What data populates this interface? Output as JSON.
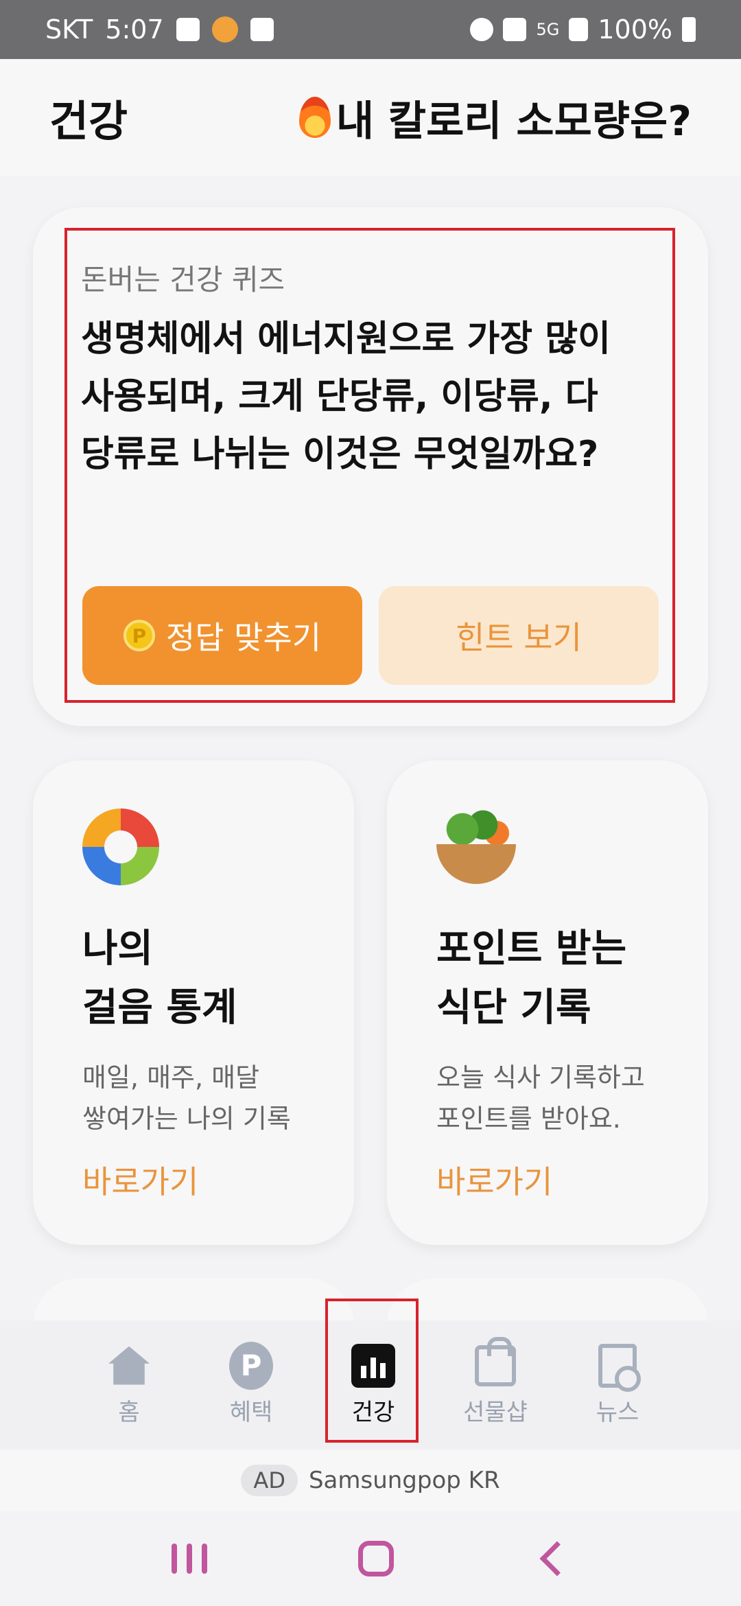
{
  "status_bar": {
    "carrier": "SKT",
    "time": "5:07",
    "battery": "100%",
    "network": "5G"
  },
  "header": {
    "title": "건강",
    "promo": "내 칼로리 소모량은?"
  },
  "quiz": {
    "eyebrow": "돈버는 건강 퀴즈",
    "question": "생명체에서 에너지원으로 가장 많이 사용되며, 크게 단당류, 이당류, 다당류로 나뉘는 이것은 무엇일까요?",
    "answer_label": "정답 맞추기",
    "coin_letter": "P",
    "hint_label": "힌트 보기"
  },
  "features": [
    {
      "title_line1": "나의",
      "title_line2": "걸음 통계",
      "desc_line1": "매일, 매주, 매달",
      "desc_line2": "쌓여가는 나의 기록",
      "link": "바로가기"
    },
    {
      "title_line1": "포인트 받는",
      "title_line2": "식단 기록",
      "desc_line1": "오늘 식사 기록하고",
      "desc_line2": "포인트를 받아요.",
      "link": "바로가기"
    }
  ],
  "nav": [
    {
      "label": "홈",
      "icon": "home-icon"
    },
    {
      "label": "혜택",
      "icon": "points-icon"
    },
    {
      "label": "건강",
      "icon": "health-chart-icon"
    },
    {
      "label": "선물샵",
      "icon": "shopping-bag-icon"
    },
    {
      "label": "뉴스",
      "icon": "news-search-icon"
    }
  ],
  "nav_letter_p": "P",
  "ad": {
    "badge": "AD",
    "text": "Samsungpop KR"
  },
  "colors": {
    "accent": "#f1922f",
    "hint_bg": "#fbe7cd",
    "link": "#e9943c",
    "highlight": "#d8222c"
  }
}
